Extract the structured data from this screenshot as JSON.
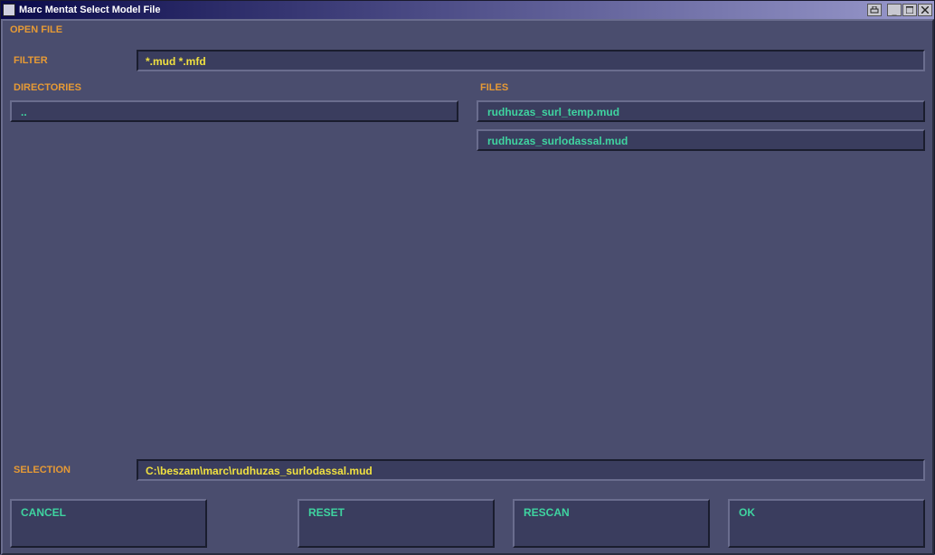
{
  "titlebar": {
    "title": "Marc Mentat Select Model File"
  },
  "panel": {
    "header": "OPEN FILE",
    "filter_label": "FILTER",
    "filter_value": "*.mud *.mfd",
    "directories_label": "DIRECTORIES",
    "files_label": "FILES",
    "directories": [
      ".."
    ],
    "files": [
      "rudhuzas_surl_temp.mud",
      "rudhuzas_surlodassal.mud"
    ],
    "selection_label": "SELECTION",
    "selection_value": "C:\\beszam\\marc\\rudhuzas_surlodassal.mud"
  },
  "actions": {
    "cancel": "CANCEL",
    "reset": "RESET",
    "rescan": "RESCAN",
    "ok": "OK"
  }
}
